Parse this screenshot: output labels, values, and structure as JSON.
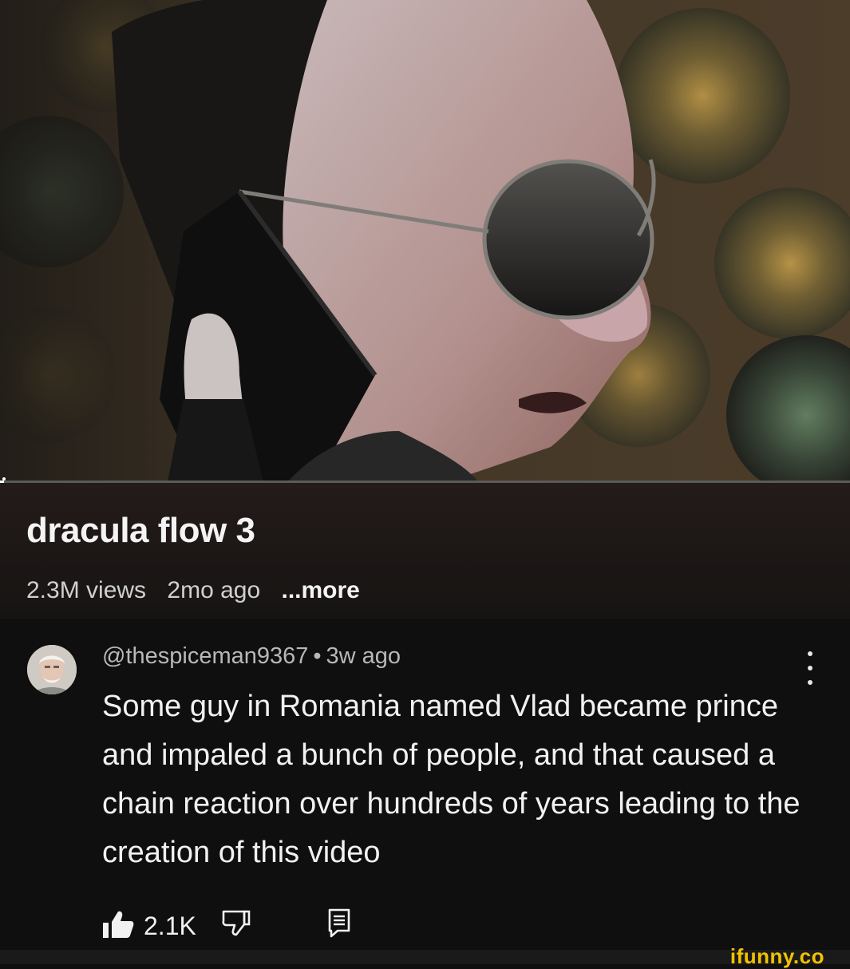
{
  "video": {
    "title": "dracula flow 3",
    "views": "2.3M views",
    "age": "2mo ago",
    "more_label": "...more",
    "progress_fraction": 0.005
  },
  "comment": {
    "author": "@thespiceman9367",
    "separator": "•",
    "age": "3w ago",
    "text": "Some guy in Romania named Vlad became prince and impaled a bunch of people, and that caused a chain reaction over hundreds of years leading to the creation of this video",
    "like_count": "2.1K",
    "icons": {
      "like": "thumbs-up-icon",
      "dislike": "thumbs-down-icon",
      "reply": "reply-icon",
      "menu": "more-vert-icon"
    }
  },
  "watermark": "ifunny.co",
  "colors": {
    "background": "#0f0f0f",
    "title_block": "#1c1716",
    "watermark": "#f2c200"
  }
}
